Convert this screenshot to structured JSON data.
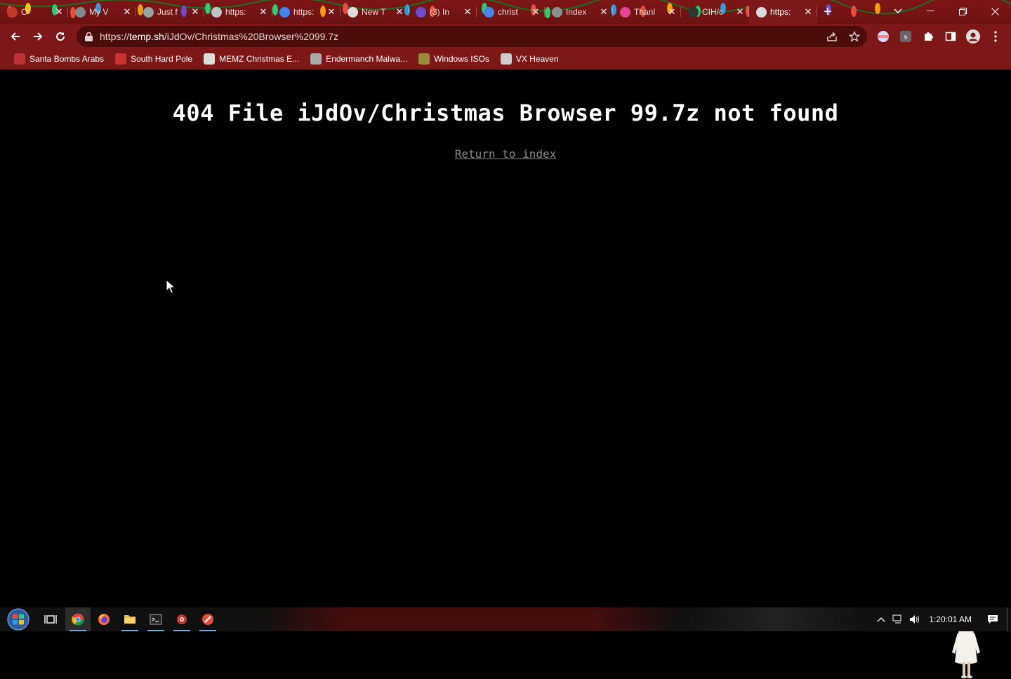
{
  "browser": {
    "tabs": [
      {
        "title": "O",
        "favicon": "santa-icon",
        "color": "#c0392b",
        "active": false
      },
      {
        "title": "My V",
        "favicon": "user-icon",
        "color": "#7f8c8d",
        "active": false
      },
      {
        "title": "Just f",
        "favicon": "user-icon",
        "color": "#95a5a6",
        "active": false
      },
      {
        "title": "https:",
        "favicon": "globe-icon",
        "color": "#bdc3c7",
        "active": false
      },
      {
        "title": "https:",
        "favicon": "google-icon",
        "color": "#4285f4",
        "active": false
      },
      {
        "title": "New T",
        "favicon": "chrome-icon",
        "color": "#dddddd",
        "active": false
      },
      {
        "title": "(3) In",
        "favicon": "mail-icon",
        "color": "#6a4ccf",
        "active": false
      },
      {
        "title": "christ",
        "favicon": "google-icon",
        "color": "#4285f4",
        "active": false
      },
      {
        "title": "Index",
        "favicon": "shield-icon",
        "color": "#8c8c8c",
        "active": false
      },
      {
        "title": "Thanl",
        "favicon": "alert-icon",
        "color": "#e84393",
        "active": false
      },
      {
        "title": "CIH/c",
        "favicon": "github-icon",
        "color": "#333333",
        "active": false
      },
      {
        "title": "https:",
        "favicon": "globe-icon",
        "color": "#dddddd",
        "active": true
      }
    ],
    "new_tab_label": "+",
    "address": {
      "scheme": "https://",
      "host": "temp.sh",
      "path": "/iJdOv/Christmas%20Browser%2099.7z"
    },
    "bookmarks": [
      {
        "label": "Santa Bombs Arabs",
        "icon": "santa-icon",
        "color": "#b33"
      },
      {
        "label": "South Hard Pole",
        "icon": "snowflake-icon",
        "color": "#c33"
      },
      {
        "label": "MEMZ Christmas E...",
        "icon": "image-icon",
        "color": "#ddd"
      },
      {
        "label": "Endermanch Malwa...",
        "icon": "skull-icon",
        "color": "#aaa"
      },
      {
        "label": "Windows ISOs",
        "icon": "tree-icon",
        "color": "#9a8a3a"
      },
      {
        "label": "VX Heaven",
        "icon": "biohazard-icon",
        "color": "#ccc"
      }
    ]
  },
  "page": {
    "heading": "404 File iJdOv/Christmas Browser 99.7z not found",
    "return_link": "Return to index"
  },
  "taskbar": {
    "clock": "1:20:01 AM",
    "apps": [
      "chrome-icon",
      "firefox-icon",
      "folder-icon",
      "terminal-icon",
      "app-icon",
      "app2-icon"
    ]
  }
}
